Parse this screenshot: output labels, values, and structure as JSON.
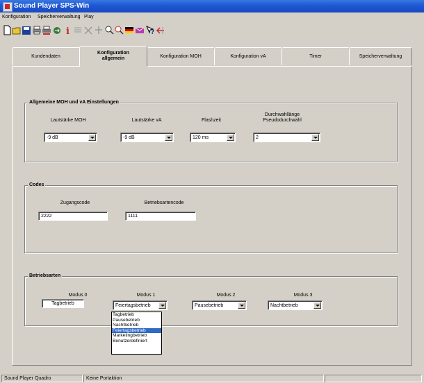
{
  "window": {
    "title": "Sound Player SPS-Win"
  },
  "menu": [
    "Konfiguration",
    "Speicherverwaltung",
    "Play"
  ],
  "toolbar_icons": [
    "new-document-icon",
    "open-folder-icon",
    "save-icon",
    "print-icon",
    "print-preview-icon",
    "transfer-icon",
    "info-icon",
    "list-icon",
    "delete-icon",
    "add-icon",
    "search-icon",
    "zoom-icon",
    "flag-icon",
    "envelope-icon",
    "help-icon",
    "arrow-icon"
  ],
  "tabs": [
    {
      "label": "Kundendaten",
      "active": false
    },
    {
      "label_line1": "Konfiguration",
      "label_line2": "allgemein",
      "active": true
    },
    {
      "label": "Konfiguration MOH",
      "active": false
    },
    {
      "label": "Konfiguration vA",
      "active": false
    },
    {
      "label": "Timer",
      "active": false
    },
    {
      "label": "Speicherverwaltung",
      "active": false
    }
  ],
  "groups": {
    "moh_va": {
      "title": "Allgemeine MOH und vA Einstellungen",
      "fields": [
        {
          "label": "Lautstärke MOH",
          "value": "-9 dB"
        },
        {
          "label": "Lautstärke vA",
          "value": "-9 dB"
        },
        {
          "label": "Flashzeit",
          "value": "120 ms"
        },
        {
          "label_line1": "Durchwahllänge",
          "label_line2": "Pseudodurchwahl",
          "value": "2"
        }
      ]
    },
    "codes": {
      "title": "Codes",
      "fields": [
        {
          "label": "Zugangscode",
          "value": "2222"
        },
        {
          "label": "Betriebsartencode",
          "value": "1111"
        }
      ]
    },
    "betriebsarten": {
      "title": "Betriebsarten",
      "modes": [
        {
          "label": "Modus 0",
          "value": "Tagbetrieb"
        },
        {
          "label": "Modus 1",
          "value": "Feiertagsbetrieb"
        },
        {
          "label": "Modus 2",
          "value": "Pausebetrieb"
        },
        {
          "label": "Modus 3",
          "value": "Nachtbetrieb"
        }
      ],
      "dropdown_options": [
        "Tagbetrieb",
        "Pausebetrieb",
        "Nachtbetrieb",
        "Feiertagsbetrieb",
        "Marketingbetrieb",
        "Benutzerdefiniert"
      ],
      "dropdown_selected": "Feiertagsbetrieb"
    }
  },
  "status": {
    "left": "Sound Player Quadro",
    "middle": "Keine Portaktion"
  },
  "colors": {
    "titlebar": "#1f5ad6",
    "selection": "#316ac5",
    "face": "#d4d0c8"
  }
}
